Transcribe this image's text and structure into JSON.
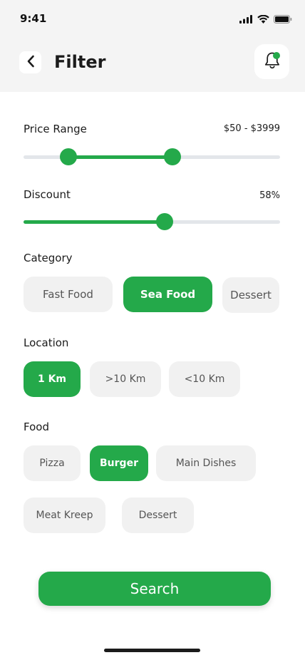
{
  "status_bar": {
    "time": "9:41"
  },
  "header": {
    "title": "Filter"
  },
  "price_range": {
    "label": "Price Range",
    "value": "$50 - $3999",
    "low_fraction": 0.175,
    "high_fraction": 0.58
  },
  "discount": {
    "label": "Discount",
    "value": "58%",
    "fraction": 0.55
  },
  "category": {
    "title": "Category",
    "options": [
      "Fast Food",
      "Sea Food",
      "Dessert"
    ],
    "selected": "Sea Food"
  },
  "location": {
    "title": "Location",
    "options": [
      "1 Km",
      ">10 Km",
      "<10 Km"
    ],
    "selected": "1 Km"
  },
  "food": {
    "title": "Food",
    "options": [
      "Pizza",
      "Burger",
      "Main Dishes",
      "Meat Kreep",
      "Dessert"
    ],
    "selected": "Burger"
  },
  "search_button": {
    "label": "Search"
  },
  "colors": {
    "accent": "#24a94a",
    "chip_bg": "#f1f1f1",
    "track": "#e3e6ea",
    "header_bg": "#f4f4f4"
  }
}
